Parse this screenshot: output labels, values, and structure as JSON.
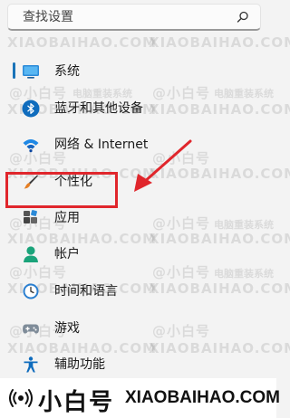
{
  "search": {
    "placeholder": "查找设置"
  },
  "nav": [
    {
      "label": "系统",
      "icon": "system-monitor-icon",
      "active": true
    },
    {
      "label": "蓝牙和其他设备",
      "icon": "bluetooth-icon"
    },
    {
      "label": "网络 & Internet",
      "icon": "wifi-icon"
    },
    {
      "label": "个性化",
      "icon": "brush-icon"
    },
    {
      "label": "应用",
      "icon": "apps-icon",
      "highlighted": true
    },
    {
      "label": "帐户",
      "icon": "account-icon"
    },
    {
      "label": "时间和语言",
      "icon": "clock-globe-icon"
    },
    {
      "label": "游戏",
      "icon": "gamepad-icon"
    },
    {
      "label": "辅助功能",
      "icon": "accessibility-icon"
    }
  ],
  "watermark": {
    "brand_small": "@小白号",
    "domain": "XIAOBAIHAO.COM",
    "tagline": "电脑重装系统",
    "footer_brand": "小白号",
    "footer_domain": "XIAOBAIHAO.COM"
  },
  "colors": {
    "background": "#f3f3f3",
    "accent": "#1a73b8",
    "highlight_box": "#e0262c",
    "arrow": "#e0262c"
  }
}
